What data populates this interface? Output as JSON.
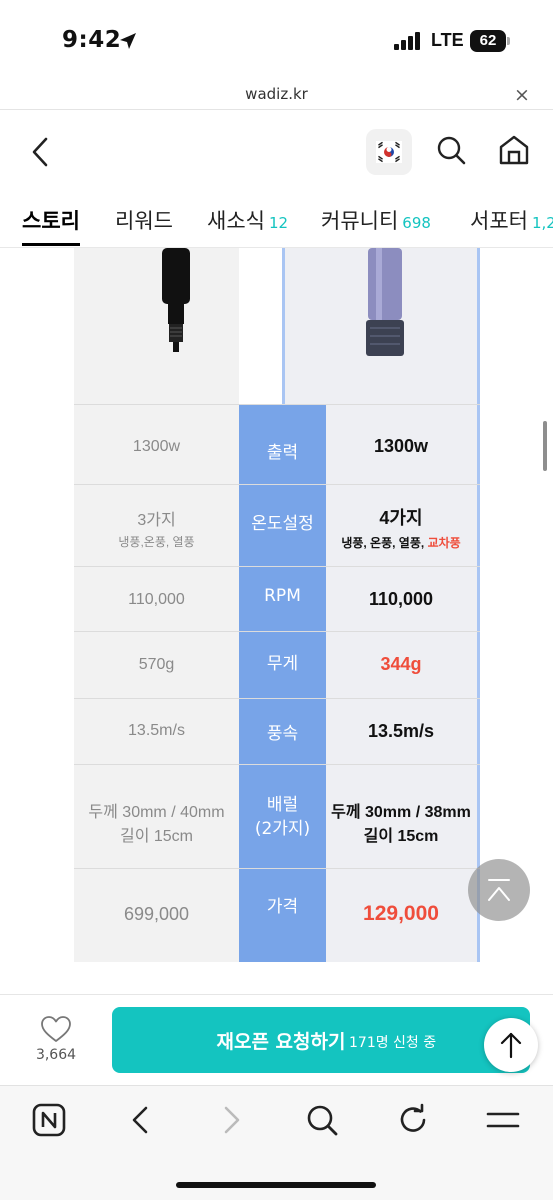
{
  "status": {
    "time": "9:42",
    "network": "LTE",
    "battery": "62"
  },
  "browser": {
    "url": "wadiz.kr",
    "close_label": "×"
  },
  "header": {
    "icons": [
      "back-icon",
      "korea-flag-icon",
      "search-icon",
      "home-icon"
    ]
  },
  "tabs": [
    {
      "label": "스토리",
      "count": ""
    },
    {
      "label": "리워드",
      "count": ""
    },
    {
      "label": "새소식",
      "count": "12"
    },
    {
      "label": "커뮤니티",
      "count": "698"
    },
    {
      "label": "서포터",
      "count": "1,2"
    }
  ],
  "comparison": {
    "rows": [
      {
        "label": "출력",
        "other": "1300w",
        "other_sub": "",
        "ours": "1300w",
        "ours_sub": "",
        "ours_sub_highlight": ""
      },
      {
        "label": "온도설정",
        "other": "3가지",
        "other_sub": "냉풍,온풍, 열풍",
        "ours": "4가지",
        "ours_sub": "냉풍, 온풍, 열풍, ",
        "ours_sub_highlight": "교차풍"
      },
      {
        "label": "RPM",
        "other": "110,000",
        "other_sub": "",
        "ours": "110,000",
        "ours_sub": "",
        "ours_sub_highlight": ""
      },
      {
        "label": "무게",
        "other": "570g",
        "other_sub": "",
        "ours": "344g",
        "ours_sub": "",
        "ours_sub_highlight": ""
      },
      {
        "label": "풍속",
        "other": "13.5m/s",
        "other_sub": "",
        "ours": "13.5m/s",
        "ours_sub": "",
        "ours_sub_highlight": ""
      },
      {
        "label_line1": "배럴",
        "label_line2": "(2가지)",
        "other_line1": "두께 30mm / 40mm",
        "other_line2": "길이 15cm",
        "ours_line1": "두께 30mm / 38mm",
        "ours_line2": "길이 15cm"
      },
      {
        "label": "가격",
        "other": "699,000",
        "ours": "129,000"
      }
    ],
    "colors": {
      "label_column": "#78a4e8",
      "highlight": "#ef4d3b"
    }
  },
  "action_bar": {
    "like_count": "3,664",
    "reopen_label": "재오픈 요청하기",
    "reopen_sub": "171명 신청 중",
    "brand_color": "#14c4c0"
  },
  "toolbar": {
    "icons": [
      "naver-n-icon",
      "back-arrow-icon",
      "forward-arrow-icon",
      "search-icon",
      "refresh-icon",
      "menu-icon"
    ]
  }
}
